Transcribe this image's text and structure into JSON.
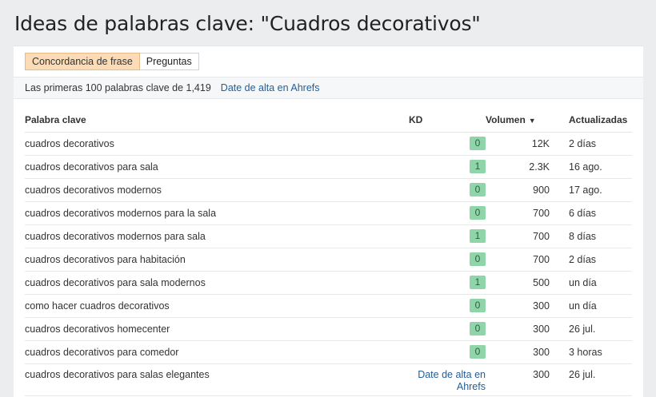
{
  "page": {
    "title": "Ideas de palabras clave: \"Cuadros decorativos\""
  },
  "tabs": [
    {
      "label": "Concordancia de frase",
      "active": true
    },
    {
      "label": "Preguntas",
      "active": false
    }
  ],
  "summary": {
    "text": "Las primeras 100 palabras clave de 1,419",
    "link": "Date de alta en Ahrefs"
  },
  "table": {
    "headers": {
      "keyword": "Palabra clave",
      "kd": "KD",
      "volume": "Volumen",
      "updated": "Actualizadas"
    },
    "sort_icon": "caret-down-icon",
    "rows": [
      {
        "keyword": "cuadros decorativos",
        "kd": "0",
        "volume": "12K",
        "updated": "2 días"
      },
      {
        "keyword": "cuadros decorativos para sala",
        "kd": "1",
        "volume": "2.3K",
        "updated": "16 ago."
      },
      {
        "keyword": "cuadros decorativos modernos",
        "kd": "0",
        "volume": "900",
        "updated": "17 ago."
      },
      {
        "keyword": "cuadros decorativos modernos para la sala",
        "kd": "0",
        "volume": "700",
        "updated": "6 días"
      },
      {
        "keyword": "cuadros decorativos modernos para sala",
        "kd": "1",
        "volume": "700",
        "updated": "8 días"
      },
      {
        "keyword": "cuadros decorativos para habitación",
        "kd": "0",
        "volume": "700",
        "updated": "2 días"
      },
      {
        "keyword": "cuadros decorativos para sala modernos",
        "kd": "1",
        "volume": "500",
        "updated": "un día"
      },
      {
        "keyword": "como hacer cuadros decorativos",
        "kd": "0",
        "volume": "300",
        "updated": "un día"
      },
      {
        "keyword": "cuadros decorativos homecenter",
        "kd": "0",
        "volume": "300",
        "updated": "26 jul."
      },
      {
        "keyword": "cuadros decorativos para comedor",
        "kd": "0",
        "volume": "300",
        "updated": "3 horas"
      }
    ],
    "last_row": {
      "keyword": "cuadros decorativos para salas elegantes",
      "kd_link_line1": "Date de alta en",
      "kd_link_line2": "Ahrefs",
      "volume": "300",
      "updated": "26 jul."
    }
  },
  "colors": {
    "accent_tab": "#fcdcb7",
    "kd_badge": "#8fd5a9",
    "link": "#1f5e9c",
    "background": "#ecedee"
  }
}
